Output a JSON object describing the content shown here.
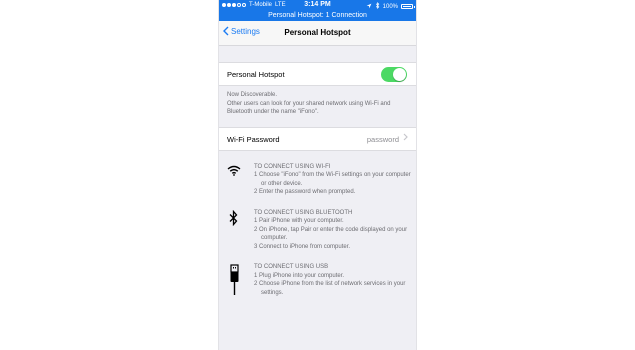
{
  "status_bar": {
    "carrier": "T-Mobile",
    "network": "LTE",
    "time": "3:14 PM",
    "battery": "100%",
    "battery_level": 1.0,
    "banner": "Personal Hotspot: 1 Connection"
  },
  "nav": {
    "back_label": "Settings",
    "title": "Personal Hotspot"
  },
  "hotspot": {
    "label": "Personal Hotspot",
    "enabled": true,
    "toggle_color": "#4cd964",
    "footer_line1": "Now Discoverable.",
    "footer_line2": "Other users can look for your shared network using Wi-Fi and Bluetooth under the name \"iFono\"."
  },
  "wifi_password": {
    "label": "Wi-Fi Password",
    "value": "password"
  },
  "instructions": {
    "wifi": {
      "icon": "wifi-icon",
      "heading": "TO CONNECT USING WI-FI",
      "step1": "1 Choose \"iFono\" from the Wi-Fi settings on your computer or other device.",
      "step2": "2 Enter the password when prompted."
    },
    "bluetooth": {
      "icon": "bluetooth-icon",
      "heading": "TO CONNECT USING BLUETOOTH",
      "step1": "1 Pair iPhone with your computer.",
      "step2": "2 On iPhone, tap Pair or enter the code displayed on your computer.",
      "step3": "3 Connect to iPhone from computer."
    },
    "usb": {
      "icon": "usb-icon",
      "heading": "TO CONNECT USING USB",
      "step1": "1 Plug iPhone into your computer.",
      "step2": "2 Choose iPhone from the list of network services in your settings."
    }
  },
  "colors": {
    "status_bar": "#1877e8",
    "accent": "#1a7bf3",
    "background": "#efeff4"
  }
}
